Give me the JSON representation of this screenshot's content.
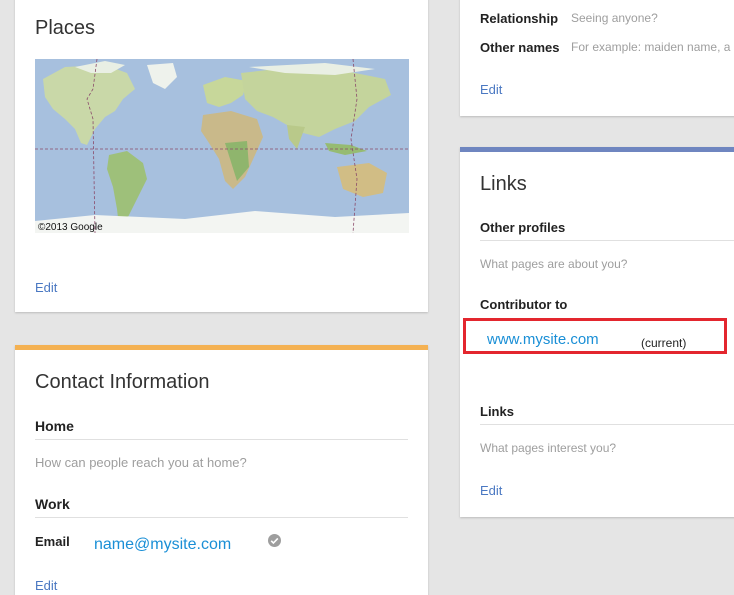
{
  "places": {
    "title": "Places",
    "map_credit": "©2013 Google",
    "edit_label": "Edit"
  },
  "contact": {
    "title": "Contact Information",
    "home_label": "Home",
    "home_placeholder": "How can people reach you at home?",
    "work_label": "Work",
    "email_label": "Email",
    "email_value": "name@mysite.com",
    "edit_label": "Edit",
    "accent_color": "#f4b152"
  },
  "about": {
    "relationship_label": "Relationship",
    "relationship_placeholder": "Seeing anyone?",
    "other_names_label": "Other names",
    "other_names_placeholder": "For example: maiden name, a",
    "edit_label": "Edit"
  },
  "links": {
    "title": "Links",
    "other_profiles_label": "Other profiles",
    "other_profiles_placeholder": "What pages are about you?",
    "contributor_label": "Contributor to",
    "contributor_site": "www.mysite.com",
    "contributor_status": "(current)",
    "links_label": "Links",
    "links_placeholder": "What pages interest you?",
    "edit_label": "Edit",
    "accent_color": "#6f86c0"
  },
  "highlight_color": "#e3262e"
}
